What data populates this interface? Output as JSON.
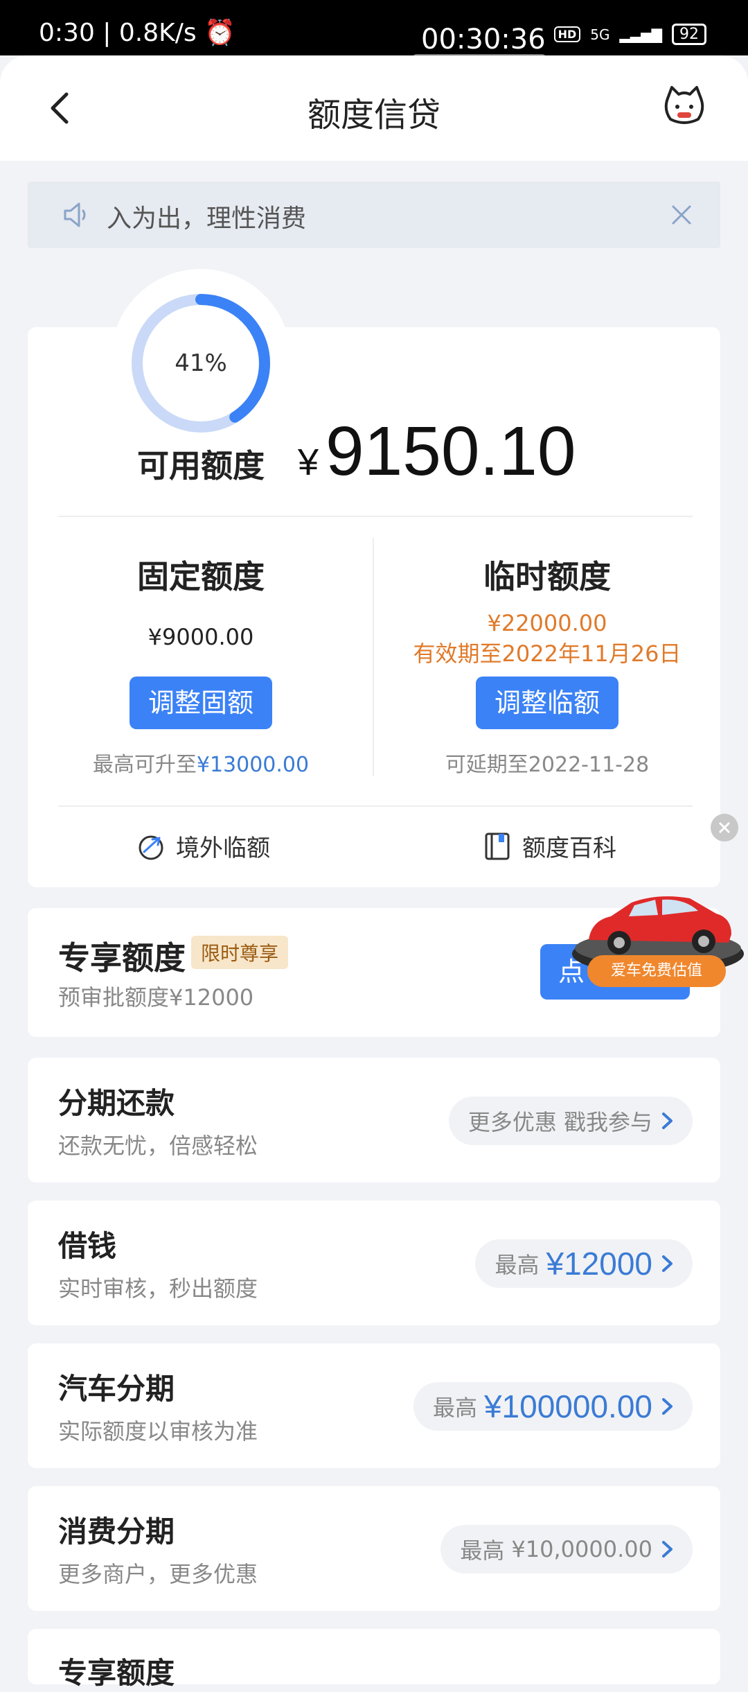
{
  "status_bar": {
    "time": "0:30",
    "net_speed": "0.8K/s",
    "clock_center": "00:30:36",
    "hd": "HD",
    "network": "5G",
    "battery": "92"
  },
  "header": {
    "title": "额度信贷"
  },
  "notice": {
    "text": "入为出，理性消费"
  },
  "quota": {
    "percent_label": "41%",
    "percent_value": 0.41,
    "available_label": "可用额度",
    "currency": "¥",
    "available_amount": "9150.10",
    "fixed": {
      "title": "固定额度",
      "amount": "¥9000.00",
      "button": "调整固额",
      "note_prefix": "最高可升至",
      "note_value": "¥13000.00"
    },
    "temp": {
      "title": "临时额度",
      "amount": "¥22000.00",
      "validity": "有效期至2022年11月26日",
      "button": "调整临额",
      "note": "可延期至2022-11-28"
    },
    "tools": [
      {
        "label": "境外临额",
        "icon": "plane-globe-icon"
      },
      {
        "label": "额度百科",
        "icon": "book-icon"
      }
    ]
  },
  "exclusive": {
    "title": "专享额度",
    "tag": "限时尊享",
    "subtitle": "预审批额度¥12000",
    "button": "点"
  },
  "car_ad": {
    "label": "爱车免费估值"
  },
  "services": [
    {
      "title": "分期还款",
      "subtitle": "还款无忧，倍感轻松",
      "pill_text": "更多优惠 戳我参与"
    },
    {
      "title": "借钱",
      "subtitle": "实时审核，秒出额度",
      "pill_prefix": "最高",
      "pill_amount": "¥12000"
    },
    {
      "title": "汽车分期",
      "subtitle": "实际额度以审核为准",
      "pill_prefix": "最高",
      "pill_amount": "¥100000.00"
    },
    {
      "title": "消费分期",
      "subtitle": "更多商户，更多优惠",
      "pill_prefix": "最高",
      "pill_amount": "¥10,0000.00"
    }
  ],
  "next_card": {
    "title": "专享额度"
  },
  "colors": {
    "accent": "#3b82f6",
    "ring_bg": "#c9d9f7",
    "orange": "#e07a2a"
  }
}
